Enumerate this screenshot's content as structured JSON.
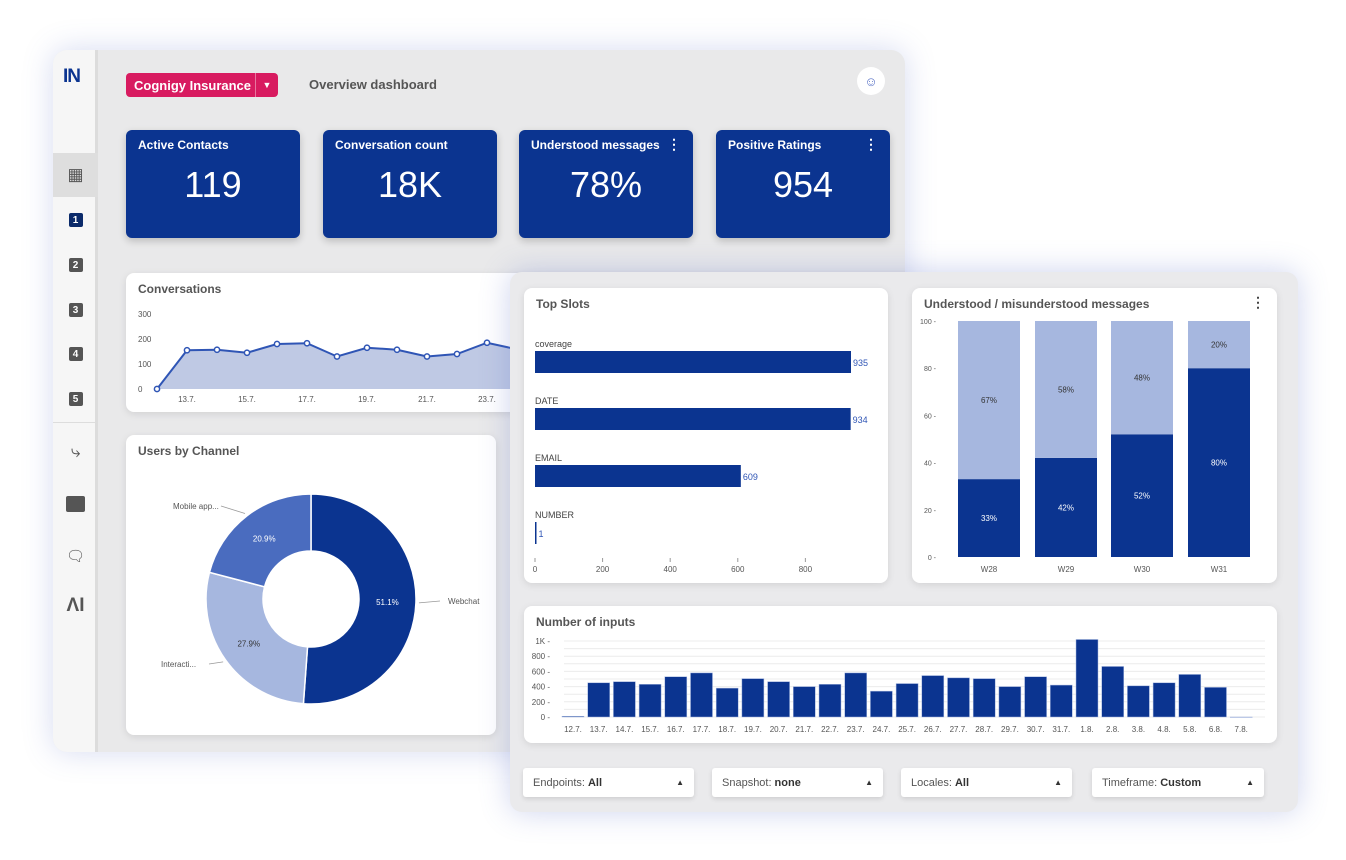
{
  "sidebar": {
    "logo": "IN",
    "items": [
      {
        "icon": "grid-icon"
      },
      {
        "label": "1"
      },
      {
        "label": "2"
      },
      {
        "label": "3"
      },
      {
        "label": "4"
      },
      {
        "label": "5"
      },
      {
        "icon": "flow-split-icon"
      },
      {
        "icon": "message-icon"
      },
      {
        "icon": "conversations-icon"
      },
      {
        "icon": "ai-icon"
      }
    ]
  },
  "header": {
    "project": "Cognigy Insurance",
    "title": "Overview dashboard"
  },
  "kpis": [
    {
      "label": "Active Contacts",
      "value": "119"
    },
    {
      "label": "Conversation count",
      "value": "18K"
    },
    {
      "label": "Understood messages",
      "value": "78%"
    },
    {
      "label": "Positive Ratings",
      "value": "954"
    }
  ],
  "colors": {
    "brand": "#0b3490",
    "accent": "#d81b60",
    "light": "#a6b7df",
    "mid": "#4a6cbf"
  },
  "filters": [
    {
      "label": "Endpoints:",
      "value": "All"
    },
    {
      "label": "Snapshot:",
      "value": "none"
    },
    {
      "label": "Locales:",
      "value": "All"
    },
    {
      "label": "Timeframe:",
      "value": "Custom"
    }
  ],
  "chart_data": [
    {
      "id": "conversations",
      "type": "area",
      "title": "Conversations",
      "x": [
        "12.7.",
        "13.7.",
        "14.7.",
        "15.7.",
        "16.7.",
        "17.7.",
        "18.7.",
        "19.7.",
        "20.7.",
        "21.7.",
        "22.7.",
        "23.7."
      ],
      "values": [
        0,
        155,
        157,
        145,
        180,
        183,
        130,
        165,
        157,
        130,
        140,
        185
      ],
      "xticks": [
        "13.7.",
        "15.7.",
        "17.7.",
        "19.7.",
        "21.7.",
        "23.7."
      ],
      "yticks": [
        "0",
        "100",
        "200",
        "300"
      ],
      "ylim": [
        0,
        300
      ]
    },
    {
      "id": "users-by-channel",
      "type": "pie",
      "title": "Users by Channel",
      "slices": [
        {
          "name": "Webchat",
          "value": 51.1,
          "label": "51.1%"
        },
        {
          "name": "Interacti...",
          "value": 27.9,
          "label": "27.9%"
        },
        {
          "name": "Mobile app...",
          "value": 20.9,
          "label": "20.9%"
        }
      ]
    },
    {
      "id": "top-slots",
      "type": "bar",
      "orientation": "horizontal",
      "title": "Top Slots",
      "categories": [
        "coverage",
        "DATE",
        "EMAIL",
        "NUMBER"
      ],
      "values": [
        935,
        934,
        609,
        1
      ],
      "xticks": [
        "0",
        "200",
        "400",
        "600",
        "800"
      ]
    },
    {
      "id": "understood",
      "type": "bar",
      "stacked": true,
      "title": "Understood / misunderstood messages",
      "categories": [
        "W28",
        "W29",
        "W30",
        "W31"
      ],
      "series": [
        {
          "values": [
            33,
            42,
            52,
            80
          ],
          "labels": [
            "33%",
            "42%",
            "52%",
            "80%"
          ]
        },
        {
          "values": [
            67,
            58,
            48,
            20
          ],
          "labels": [
            "67%",
            "58%",
            "48%",
            "20%"
          ]
        }
      ],
      "yticks": [
        "0",
        "20",
        "40",
        "60",
        "80",
        "100"
      ],
      "ylim": [
        0,
        100
      ]
    },
    {
      "id": "inputs",
      "type": "bar",
      "title": "Number of inputs",
      "categories": [
        "12.7.",
        "13.7.",
        "14.7.",
        "15.7.",
        "16.7.",
        "17.7.",
        "18.7.",
        "19.7.",
        "20.7.",
        "21.7.",
        "22.7.",
        "23.7.",
        "24.7.",
        "25.7.",
        "26.7.",
        "27.7.",
        "28.7.",
        "29.7.",
        "30.7.",
        "31.7.",
        "1.8.",
        "2.8.",
        "3.8.",
        "4.8.",
        "5.8.",
        "6.8.",
        "7.8."
      ],
      "values": [
        10,
        450,
        465,
        430,
        530,
        580,
        380,
        505,
        465,
        400,
        430,
        580,
        340,
        440,
        545,
        515,
        505,
        400,
        530,
        420,
        1020,
        665,
        410,
        450,
        560,
        390,
        0
      ],
      "yticks": [
        "0",
        "200",
        "400",
        "600",
        "800",
        "1K"
      ],
      "ylim": [
        0,
        1000
      ]
    }
  ]
}
